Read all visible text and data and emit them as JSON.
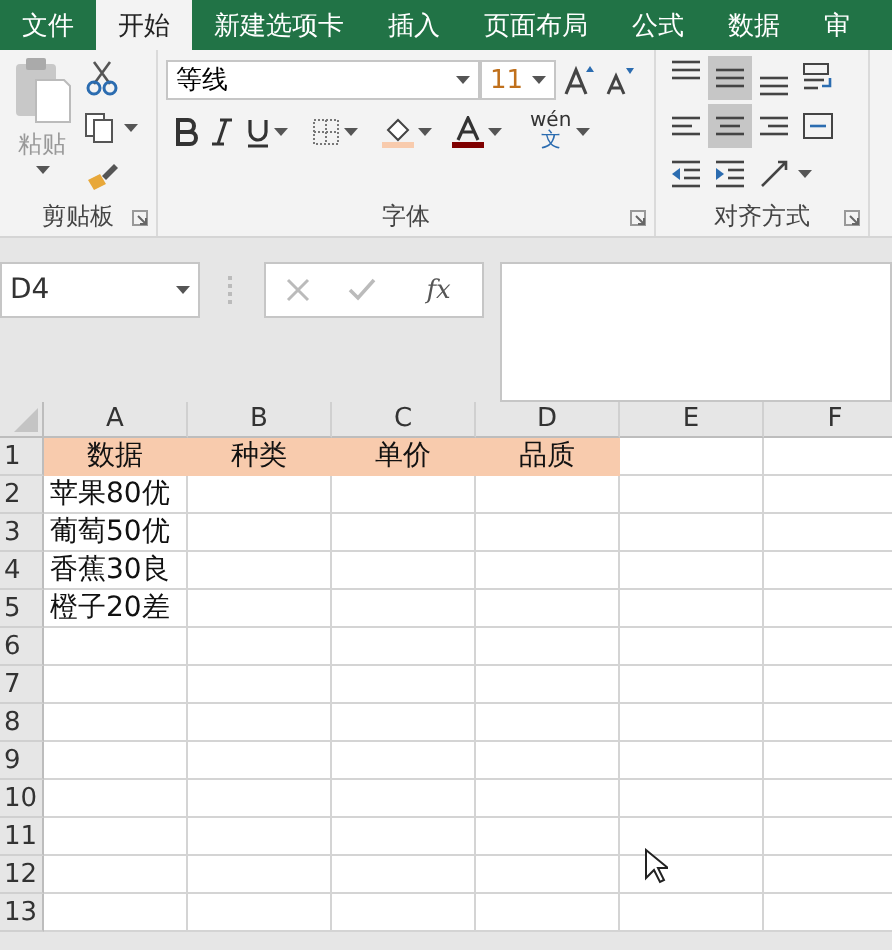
{
  "tabs": [
    {
      "label": "文件",
      "selected": false
    },
    {
      "label": "开始",
      "selected": true
    },
    {
      "label": "新建选项卡",
      "selected": false
    },
    {
      "label": "插入",
      "selected": false
    },
    {
      "label": "页面布局",
      "selected": false
    },
    {
      "label": "公式",
      "selected": false
    },
    {
      "label": "数据",
      "selected": false
    },
    {
      "label": "审",
      "selected": false
    }
  ],
  "clipboard": {
    "paste_label": "粘贴",
    "title": "剪贴板"
  },
  "font": {
    "name": "等线",
    "size": "11",
    "wen": "wén",
    "wen_char": "文",
    "title": "字体"
  },
  "alignment": {
    "title": "对齐方式",
    "buttons": [
      {
        "kind": "top",
        "selected": false
      },
      {
        "kind": "middle",
        "selected": true
      },
      {
        "kind": "bottom",
        "selected": false
      },
      {
        "kind": "wrap",
        "selected": false
      },
      {
        "kind": "left",
        "selected": false
      },
      {
        "kind": "center",
        "selected": true
      },
      {
        "kind": "right",
        "selected": false
      },
      {
        "kind": "merge",
        "selected": false
      },
      {
        "kind": "outdent",
        "selected": false
      },
      {
        "kind": "indent",
        "selected": false
      },
      {
        "kind": "orientation",
        "selected": false
      }
    ]
  },
  "formula_bar": {
    "name_box": "D4",
    "fx": "fx"
  },
  "sheet": {
    "columns": [
      "A",
      "B",
      "C",
      "D",
      "E",
      "F"
    ],
    "rows": [
      {
        "header": "1",
        "shaded": true,
        "cells": [
          "数据",
          "种类",
          "单价",
          "品质"
        ]
      },
      {
        "header": "2",
        "cells": [
          "苹果80优"
        ]
      },
      {
        "header": "3",
        "cells": [
          "葡萄50优"
        ]
      },
      {
        "header": "4",
        "cells": [
          "香蕉30良"
        ]
      },
      {
        "header": "5",
        "cells": [
          "橙子20差"
        ]
      },
      {
        "header": "6",
        "cells": []
      },
      {
        "header": "7",
        "cells": []
      },
      {
        "header": "8",
        "cells": []
      },
      {
        "header": "9",
        "cells": []
      },
      {
        "header": "10",
        "cells": []
      },
      {
        "header": "11",
        "cells": []
      },
      {
        "header": "12",
        "cells": []
      },
      {
        "header": "13",
        "cells": []
      }
    ]
  }
}
